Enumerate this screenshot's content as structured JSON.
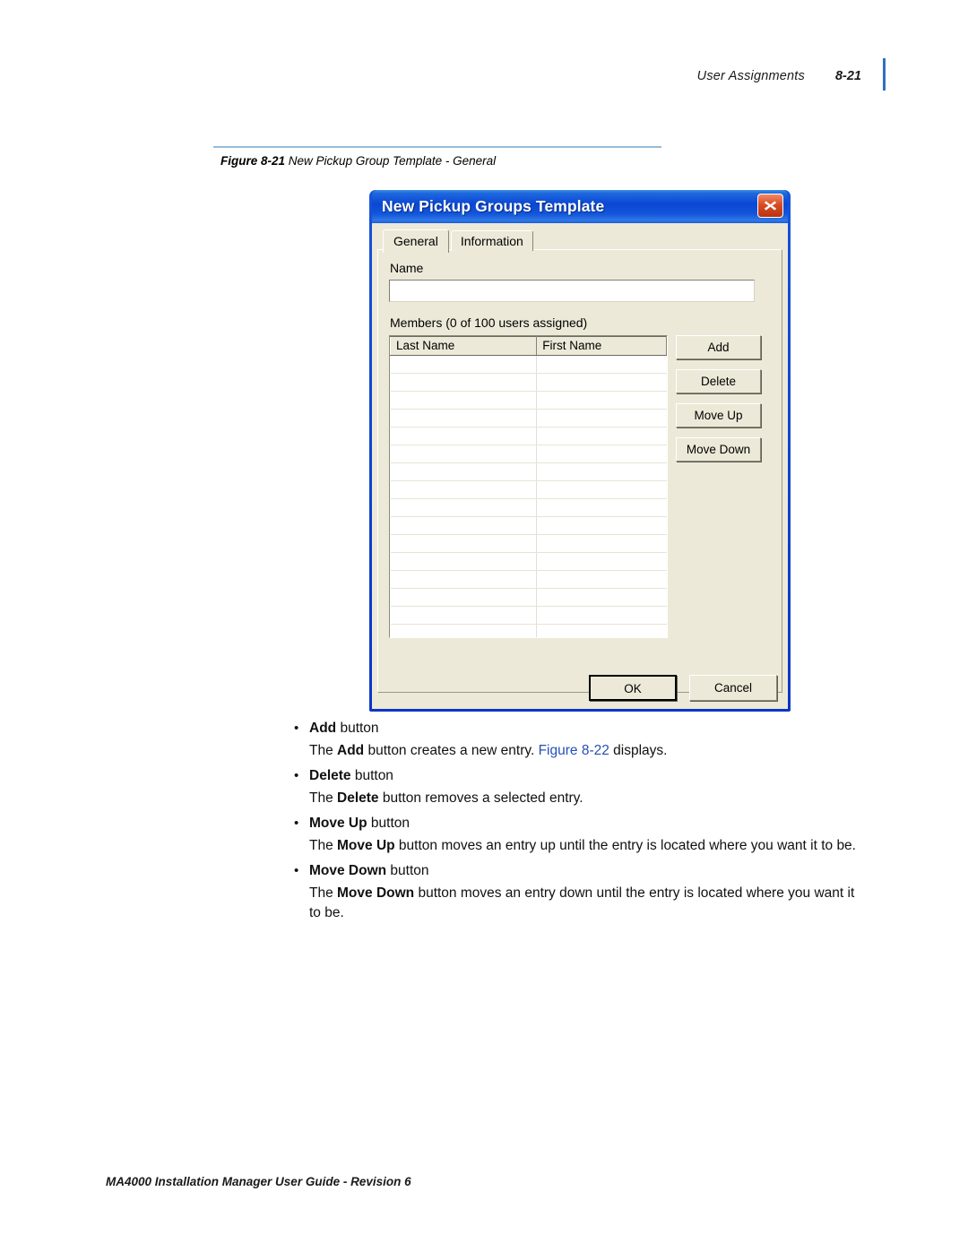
{
  "header": {
    "title": "User Assignments",
    "page_number": "8-21",
    "accent_color": "#2f6fc4"
  },
  "figure": {
    "number": "Figure 8-21",
    "caption": "New Pickup Group Template - General",
    "rule_color": "#93bddb"
  },
  "dialog": {
    "title": "New Pickup Groups Template",
    "close_icon": "close-icon",
    "tabs": [
      {
        "label": "General",
        "active": true
      },
      {
        "label": "Information",
        "active": false
      }
    ],
    "name_label": "Name",
    "name_value": "",
    "name_placeholder": "",
    "members_label": "Members (0 of 100 users assigned)",
    "grid": {
      "columns": [
        "Last Name",
        "First Name"
      ],
      "rows": [
        [
          "",
          ""
        ],
        [
          "",
          ""
        ],
        [
          "",
          ""
        ],
        [
          "",
          ""
        ],
        [
          "",
          ""
        ],
        [
          "",
          ""
        ],
        [
          "",
          ""
        ],
        [
          "",
          ""
        ],
        [
          "",
          ""
        ],
        [
          "",
          ""
        ],
        [
          "",
          ""
        ],
        [
          "",
          ""
        ],
        [
          "",
          ""
        ],
        [
          "",
          ""
        ],
        [
          "",
          ""
        ],
        [
          "",
          ""
        ],
        [
          "",
          ""
        ]
      ]
    },
    "side_buttons": [
      {
        "label": "Add"
      },
      {
        "label": "Delete"
      },
      {
        "label": "Move Up"
      },
      {
        "label": "Move Down"
      }
    ],
    "ok_label": "OK",
    "cancel_label": "Cancel",
    "titlebar_color": "#0b47d4",
    "face_color": "#ece9d8",
    "close_color": "#d94c23"
  },
  "body": {
    "items": [
      {
        "bullet_bold": "Add",
        "bullet_rest": " button",
        "desc_pre": "The ",
        "desc_bold": "Add",
        "desc_mid": " button creates a new entry. ",
        "desc_link": "Figure 8-22",
        "desc_post": " displays."
      },
      {
        "bullet_bold": "Delete",
        "bullet_rest": " button",
        "desc_pre": "The ",
        "desc_bold": "Delete",
        "desc_mid": " button removes a selected entry.",
        "desc_link": "",
        "desc_post": ""
      },
      {
        "bullet_bold": "Move Up",
        "bullet_rest": " button",
        "desc_pre": "The ",
        "desc_bold": "Move Up",
        "desc_mid": " button moves an entry up until the entry is located where you want it to be.",
        "desc_link": "",
        "desc_post": ""
      },
      {
        "bullet_bold": "Move Down",
        "bullet_rest": " button",
        "desc_pre": "The ",
        "desc_bold": "Move Down",
        "desc_mid": " button moves an entry down until the entry is located where you want it to be.",
        "desc_link": "",
        "desc_post": ""
      }
    ],
    "bullet_glyph": "•"
  },
  "footer": {
    "text": "MA4000 Installation Manager User Guide - Revision 6"
  }
}
